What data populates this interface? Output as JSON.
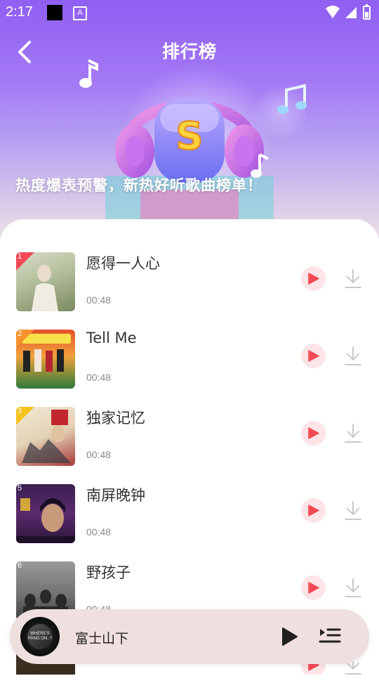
{
  "status_bar": {
    "time": "2:17",
    "notif_letter": "A"
  },
  "header": {
    "title": "排行榜",
    "slogan": "热度爆表预警，新热好听歌曲榜单！"
  },
  "songs": [
    {
      "rank": "1",
      "title": "愿得一人心",
      "duration": "00:48",
      "badge_color": "#f24a55"
    },
    {
      "rank": "2",
      "title": "Tell Me",
      "duration": "00:48",
      "badge_color": "#f7922e"
    },
    {
      "rank": "3",
      "title": "独家记忆",
      "duration": "00:48",
      "badge_color": "#f6c21a"
    },
    {
      "rank": "5",
      "title": "南屏晚钟",
      "duration": "00:48",
      "badge_color": "#9a9a9a"
    },
    {
      "rank": "6",
      "title": "野孩子",
      "duration": "00:48",
      "badge_color": "#9a9a9a"
    }
  ],
  "mini_player": {
    "title": "富士山下",
    "disc_label": "WHERE'S PANG ON..?"
  },
  "colors": {
    "accent": "#f24a55",
    "play_bg": "#fde4e6",
    "hero_top": "#8f5ff2"
  }
}
